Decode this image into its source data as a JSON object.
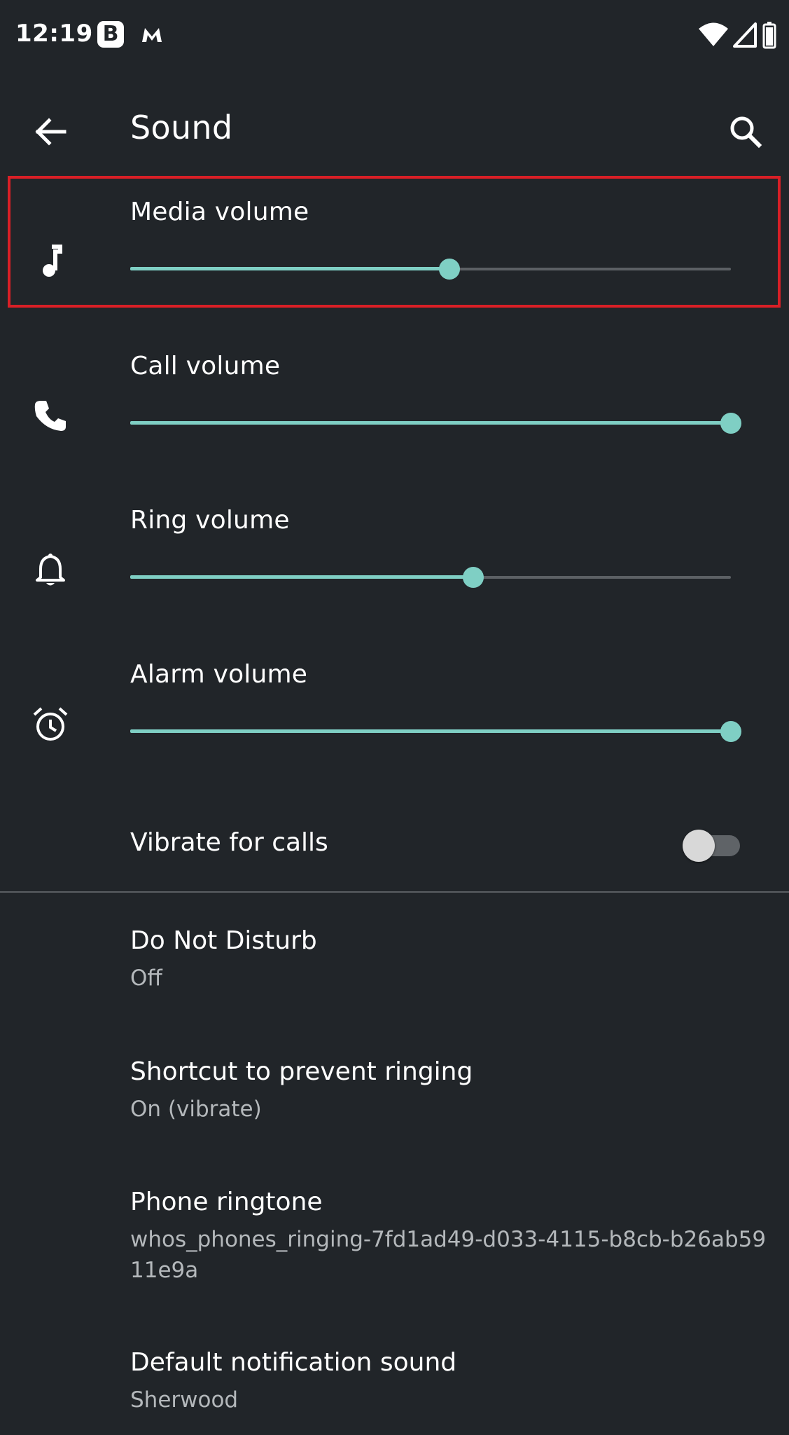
{
  "status_bar": {
    "time": "12:19",
    "notification_icons": [
      "b-app-icon",
      "malwarebytes-icon"
    ],
    "system_icons": [
      "wifi-icon",
      "cellular-signal-icon",
      "battery-icon"
    ],
    "notif_b_letter": "B"
  },
  "app_bar": {
    "title": "Sound",
    "back_icon": "arrow-back-icon",
    "search_icon": "search-icon"
  },
  "volumes": [
    {
      "label": "Media volume",
      "icon": "music-note-icon",
      "level": 0.532
    },
    {
      "label": "Call volume",
      "icon": "phone-icon",
      "level": 1.0
    },
    {
      "label": "Ring volume",
      "icon": "bell-icon",
      "level": 0.571
    },
    {
      "label": "Alarm volume",
      "icon": "alarm-clock-icon",
      "level": 1.0
    }
  ],
  "vibrate": {
    "label": "Vibrate for calls",
    "on": false
  },
  "preferences": [
    {
      "title": "Do Not Disturb",
      "summary": "Off"
    },
    {
      "title": "Shortcut to prevent ringing",
      "summary": "On (vibrate)"
    },
    {
      "title": "Phone ringtone",
      "summary": "whos_phones_ringing-7fd1ad49-d033-4115-b8cb-b26ab5911e9a"
    },
    {
      "title": "Default notification sound",
      "summary": "Sherwood"
    }
  ],
  "colors": {
    "background": "#212529",
    "accent": "#7fcfc4",
    "highlight": "#d91f26"
  }
}
